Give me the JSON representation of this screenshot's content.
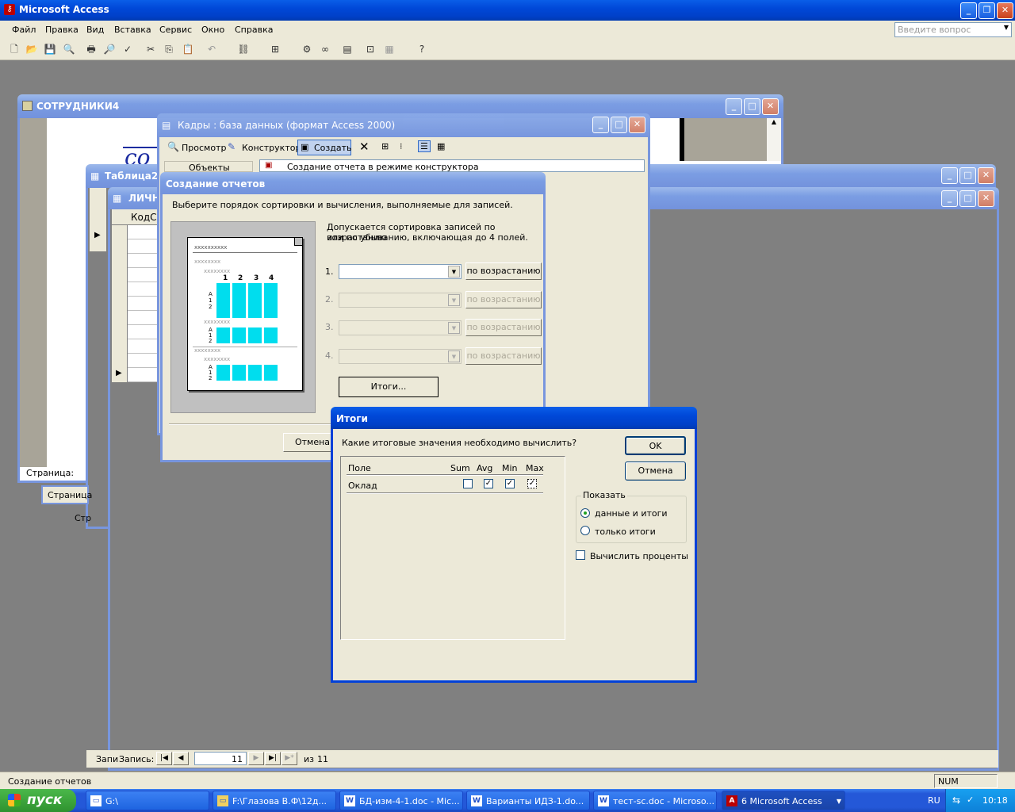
{
  "app": {
    "title": "Microsoft Access",
    "menu": [
      "Файл",
      "Правка",
      "Вид",
      "Вставка",
      "Сервис",
      "Окно",
      "Справка"
    ],
    "help_placeholder": "Введите вопрос"
  },
  "windows": {
    "sotrudniki": {
      "title": "СОТРУДНИКИ4",
      "page_label": "Страница:"
    },
    "tablica2": {
      "title": "Таблица2",
      "page_label": "Страница"
    },
    "lichn": {
      "title": "ЛИЧН",
      "col_header": "КодСо",
      "page_label": "Стр"
    },
    "kadry": {
      "title": "Кадры : база данных (формат Access 2000)",
      "tb_view": "Просмотр",
      "tb_design": "Конструктор",
      "tb_create": "Создать",
      "objects_label": "Объекты",
      "list_item": "Создание отчета в режиме конструктора"
    }
  },
  "record_nav": {
    "left_label": "Запи",
    "label": "Запись:",
    "current": "11",
    "of_label": "из",
    "total": "11"
  },
  "report_wizard": {
    "title": "Создание отчетов",
    "instruction": "Выберите порядок сортировки и вычисления, выполняемые для записей.",
    "sort_hint_line1": "Допускается сортировка записей по возрастанию",
    "sort_hint_line2": "или по убыванию, включающая до 4 полей.",
    "sort_rows": [
      {
        "num": "1.",
        "button": "по возрастанию",
        "enabled": true
      },
      {
        "num": "2.",
        "button": "по возрастанию",
        "enabled": false
      },
      {
        "num": "3.",
        "button": "по возрастанию",
        "enabled": false
      },
      {
        "num": "4.",
        "button": "по возрастанию",
        "enabled": false
      }
    ],
    "totals_button": "Итоги...",
    "cancel_button": "Отмена",
    "preview": {
      "x_label_top": "xxxxxxxxxx",
      "x_label_group": "xxxxxxxx",
      "x_label_sub": "xxxxxxxx",
      "col_numbers": [
        "1",
        "2",
        "3",
        "4"
      ],
      "row_labels": "A 1 2"
    }
  },
  "totals_dialog": {
    "title": "Итоги",
    "question": "Какие итоговые значения необходимо вычислить?",
    "headers": {
      "field": "Поле",
      "sum": "Sum",
      "avg": "Avg",
      "min": "Min",
      "max": "Max"
    },
    "rows": [
      {
        "field": "Оклад",
        "sum": false,
        "avg": true,
        "min": true,
        "max": true
      }
    ],
    "ok_button": "OK",
    "cancel_button": "Отмена",
    "show_group": "Показать",
    "radio_details": "данные и итоги",
    "radio_summary": "только итоги",
    "percent_label": "Вычислить проценты"
  },
  "status_bar": {
    "text": "Создание отчетов",
    "num": "NUM"
  },
  "taskbar": {
    "start": "пуск",
    "items": [
      {
        "icon": "drive",
        "label": "G:\\"
      },
      {
        "icon": "folder",
        "label": "F:\\Глазова В.Ф\\12д..."
      },
      {
        "icon": "W",
        "label": "БД-изм-4-1.doc - Mic..."
      },
      {
        "icon": "W",
        "label": "Варианты ИДЗ-1.do..."
      },
      {
        "icon": "W",
        "label": "тест-sc.doc - Microso..."
      },
      {
        "icon": "A",
        "label": "6 Microsoft Access"
      }
    ],
    "lang": "RU",
    "time": "10:18"
  },
  "colors": {
    "xp_blue": "#0048d8",
    "dialog_bg": "#ece9d8",
    "desktop": "#808080",
    "preview_cyan": "#00ddee"
  }
}
